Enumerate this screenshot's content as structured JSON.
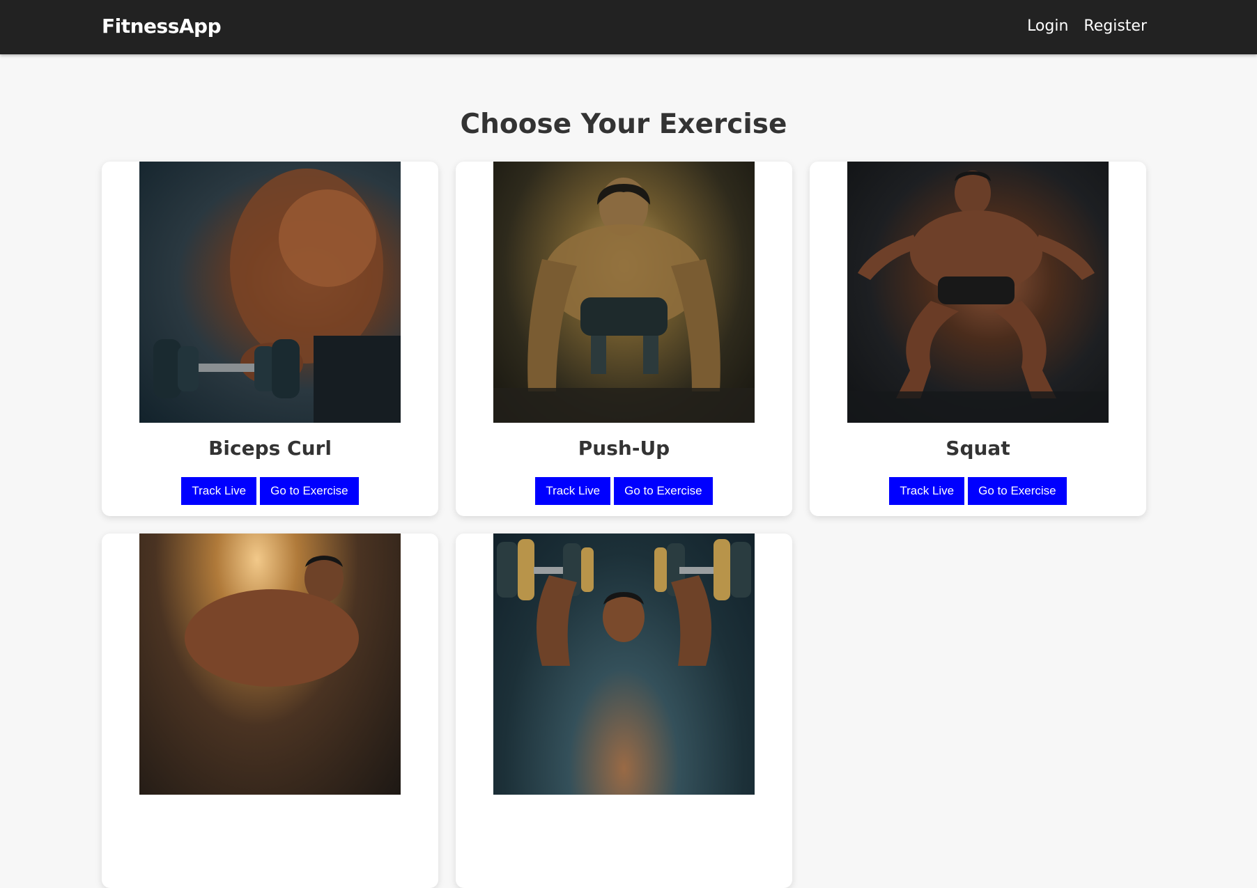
{
  "app": {
    "brand": "FitnessApp",
    "nav": {
      "login": "Login",
      "register": "Register"
    }
  },
  "main": {
    "title": "Choose Your Exercise",
    "exercises": [
      {
        "name": "Biceps Curl",
        "image": "biceps-curl-photo",
        "track_label": "Track Live",
        "go_label": "Go to Exercise"
      },
      {
        "name": "Push-Up",
        "image": "push-up-photo",
        "track_label": "Track Live",
        "go_label": "Go to Exercise"
      },
      {
        "name": "Squat",
        "image": "squat-photo",
        "track_label": "Track Live",
        "go_label": "Go to Exercise"
      },
      {
        "image": "shoulder-exercise-photo"
      },
      {
        "image": "dumbbell-press-photo"
      }
    ]
  },
  "colors": {
    "navbar": "#222222",
    "background": "#f7f7f7",
    "button": "#0000ff",
    "button_text": "#ffffff",
    "title_text": "#333333"
  }
}
